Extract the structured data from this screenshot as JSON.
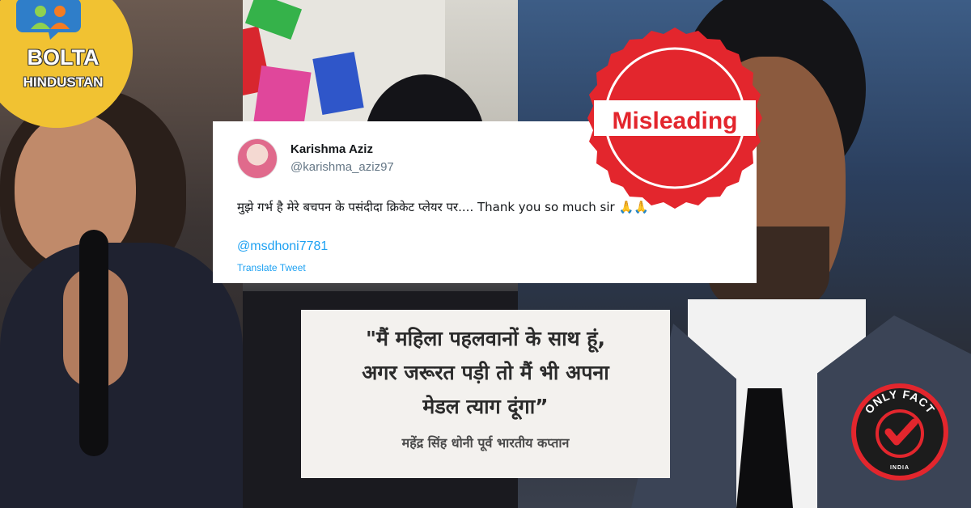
{
  "logo": {
    "line1": "BOLTA",
    "line2": "HINDUSTAN",
    "icon": "people-speech-bubble-icon"
  },
  "stamp": {
    "label": "Misleading",
    "color": "#e3262d"
  },
  "tweet": {
    "name": "Karishma Aziz",
    "handle": "@karishma_aziz97",
    "text": "मुझे गर्भ है मेरे बचपन के पसंदीदा क्रिकेट प्लेयर पर.... Thank you so much sir",
    "emoji": "🙏🙏",
    "mention": "@msdhoni7781",
    "translate": "Translate Tweet",
    "link_color": "#1da1f2"
  },
  "quote": {
    "line1": "\"मैं महिला पहलवानों के साथ हूं,",
    "line2": "अगर जरूरत पड़ी तो मैं भी अपना",
    "line3": "मेडल त्याग दूंगा”",
    "attribution": "महेंद्र सिंह धोनी पूर्व भारतीय कप्तान"
  },
  "badge": {
    "top": "ONLY FACT",
    "bottom": "INDIA",
    "icon": "checkmark-icon",
    "accent": "#e3262d"
  }
}
